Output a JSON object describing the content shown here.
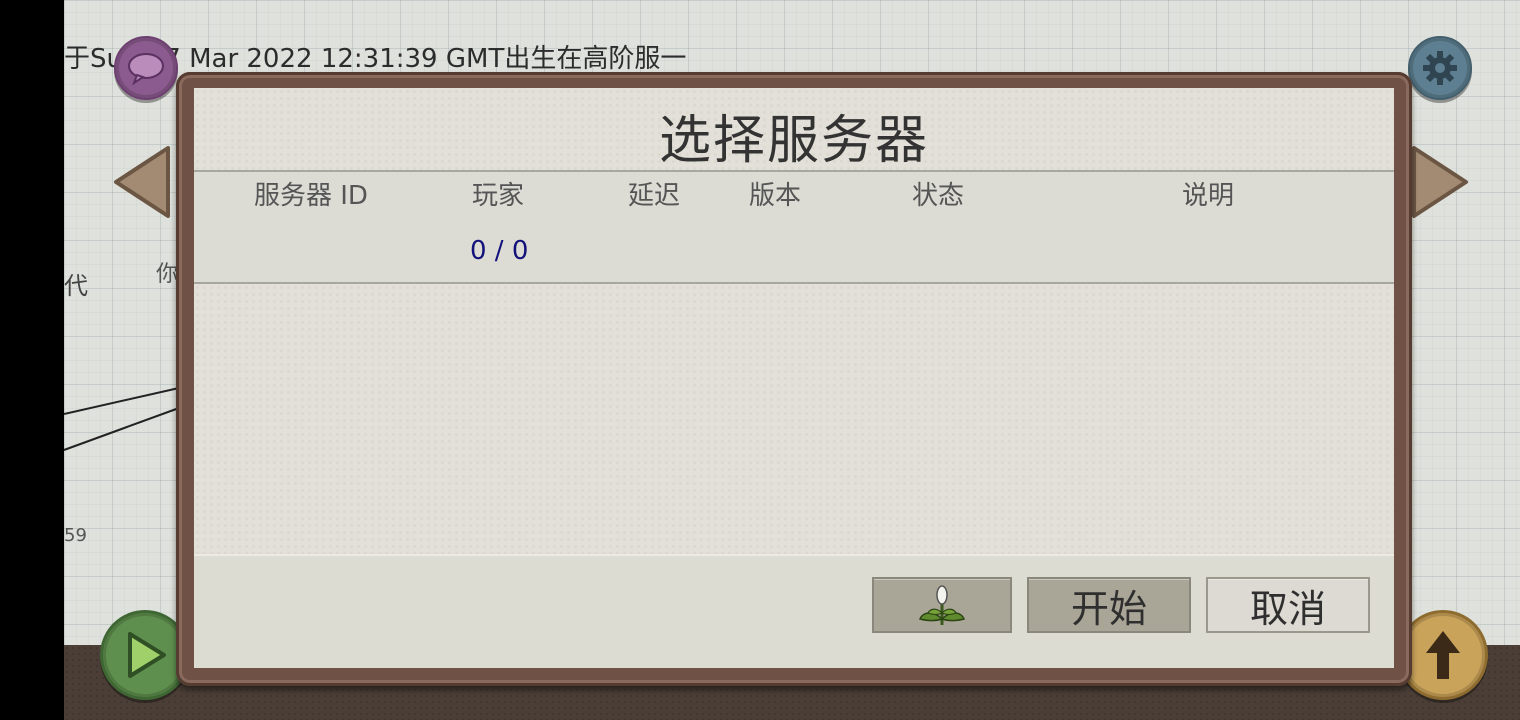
{
  "background": {
    "birth_text": "于Sun 27 Mar 2022 12:31:39 GMT出生在高阶服一",
    "side_generation": "代",
    "side_you": "你",
    "side_number": "59"
  },
  "dialog": {
    "title": "选择服务器",
    "columns": {
      "server_id": "服务器 ID",
      "players": "玩家",
      "latency": "延迟",
      "version": "版本",
      "status": "状态",
      "description": "说明"
    },
    "rows": [
      {
        "server_id": "",
        "players": "0 / 0",
        "latency": "",
        "version": "",
        "status": "",
        "description": ""
      }
    ],
    "buttons": {
      "plant_icon": "plant-icon",
      "start": "开始",
      "cancel": "取消"
    }
  },
  "icons": {
    "chat": "chat-bubble-icon",
    "settings": "gear-icon",
    "prev": "left-arrow-icon",
    "next": "right-arrow-icon",
    "play": "play-icon",
    "upgrade": "up-arrow-icon"
  },
  "colors": {
    "frame": "#6f5145",
    "panel": "#e2e0d8",
    "button": "#a9a597",
    "players_text": "#12127a"
  }
}
